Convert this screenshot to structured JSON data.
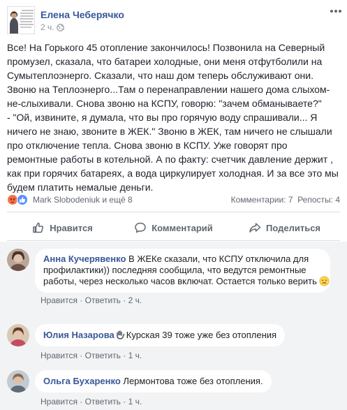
{
  "post": {
    "author": "Елена Чеберячко",
    "time": "2 ч.",
    "text_lines": [
      "Все! На Горького 45 отопление закончилось! Позвонила на Северный",
      "промузел, сказала, что батареи холодные, они меня отфутболили на",
      "Сумытеплоэнерго. Сказали, что наш дом теперь обслуживают они.",
      "Звоню на Теплоэнерго...Там о перенаправлении нашего дома слыхом-",
      "не-слыхивали. Снова звоню на КСПУ, говорю: \"зачем обманываете?\"",
      "- \"Ой, извините, я думала, что вы про горячую воду спрашивали... Я",
      "ничего не знаю, звоните в ЖЕК.\" Звоню в ЖЕК, там ничего не слышали",
      "про отключение тепла. Снова звоню в КСПУ. Уже говорят про",
      "ремонтные работы в котельной. А по факту: счетчик давление держит ,",
      "как при горячих батареях, а вода циркулирует холодная. И за все это мы",
      "будем платить немалые деньги."
    ],
    "reactions": {
      "reactors": "Mark Slobodeniuk и ещё 8",
      "comments": "Комментарии: 7",
      "reposts": "Репосты: 4"
    },
    "actions": {
      "like": "Нравится",
      "comment": "Комментарий",
      "share": "Поделиться"
    }
  },
  "comments": [
    {
      "author": "Анна Кучерявенко",
      "text_lines": [
        "В ЖЕКе сказали, что КСПУ отключила для",
        "профилактики)) последняя сообщила, что ведутся ремонтные",
        "работы, через несколько часов включат. Остается только верить"
      ],
      "like": "Нравится",
      "reply": "Ответить",
      "time": "2 ч."
    },
    {
      "author": "Юлия Назарова",
      "text": "Курская 39 тоже уже без отопления",
      "like": "Нравится",
      "reply": "Ответить",
      "time": "1 ч."
    },
    {
      "author": "Ольга Бухаренко",
      "text": "Лермонтова тоже без отопления.",
      "like": "Нравится",
      "reply": "Ответить",
      "time": "1 ч."
    }
  ],
  "colors": {
    "link": "#365899",
    "comment_author": "#385898",
    "meta": "#606770",
    "comments_bg": "#f2f3f5",
    "like_blue": "#5890ff",
    "angry_orange": "#f7714b"
  },
  "icons": [
    "globe-icon",
    "more-options-icon",
    "angry-reaction-icon",
    "like-reaction-icon",
    "thumbs-up-icon",
    "comment-bubble-icon",
    "share-arrow-icon",
    "sad-emoji-icon",
    "waving-hand-emoji-icon"
  ]
}
